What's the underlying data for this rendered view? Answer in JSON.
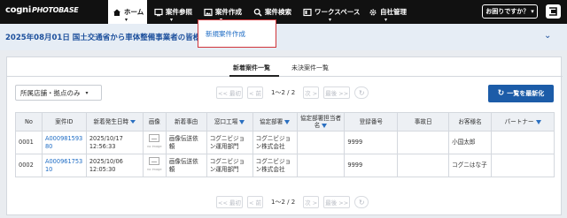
{
  "header": {
    "logo_main": "cogni",
    "logo_sub": "PHOTOBASE",
    "nav": [
      {
        "label": "ホーム"
      },
      {
        "label": "案件参照"
      },
      {
        "label": "案件作成"
      },
      {
        "label": "案件検索"
      },
      {
        "label": "ワークスペース"
      },
      {
        "label": "自社管理"
      }
    ],
    "help_label": "お困りですか？",
    "help_arrow": "▾"
  },
  "notice": {
    "text": "2025年08月01日 国土交通省から車体整備事業者の皆様へ",
    "chevron": "⌄"
  },
  "dropdown": {
    "item": "新規案件作成"
  },
  "tabs": [
    {
      "label": "新着案件一覧"
    },
    {
      "label": "未決案件一覧"
    }
  ],
  "filter": {
    "value": "所属店舗・拠点のみ",
    "arrow": "▾"
  },
  "pager": {
    "first": "<< 最初",
    "prev": "< 前",
    "page": "1〜2 / 2",
    "next": "次 >",
    "last": "最後 >>"
  },
  "refresh_label": "一覧を最新化",
  "table": {
    "headers": {
      "no": "No",
      "id": "案件ID",
      "date": "新着発生日時",
      "image": "画像",
      "reason": "新着事由",
      "factory": "窓口工場",
      "dept": "協定部署",
      "person": "協定部署担当者名",
      "reg": "登録番号",
      "accident": "事故日",
      "customer": "お客様名",
      "partner": "パートナー"
    },
    "rows": [
      {
        "no": "0001",
        "id": "A00098159380",
        "date": "2025/10/17 12:56:33",
        "image_label": "no image",
        "reason": "画像伝送依頼",
        "factory": "コグニビジョン運用部門",
        "dept": "コグニビジョン株式会社",
        "person": "",
        "reg": "9999",
        "accident": "",
        "customer": "小国太郎",
        "partner": ""
      },
      {
        "no": "0002",
        "id": "A00096175310",
        "date": "2025/10/06 12:05:30",
        "image_label": "no image",
        "reason": "画像伝送依頼",
        "factory": "コグニビジョン運用部門",
        "dept": "コグニビジョン株式会社",
        "person": "",
        "reg": "9999",
        "accident": "",
        "customer": "コグニはな子",
        "partner": ""
      }
    ]
  },
  "colors": {
    "topbar": "#111111",
    "accent": "#1c5ca8",
    "link": "#1c6bc4",
    "dropdown_border": "#d0343a"
  }
}
